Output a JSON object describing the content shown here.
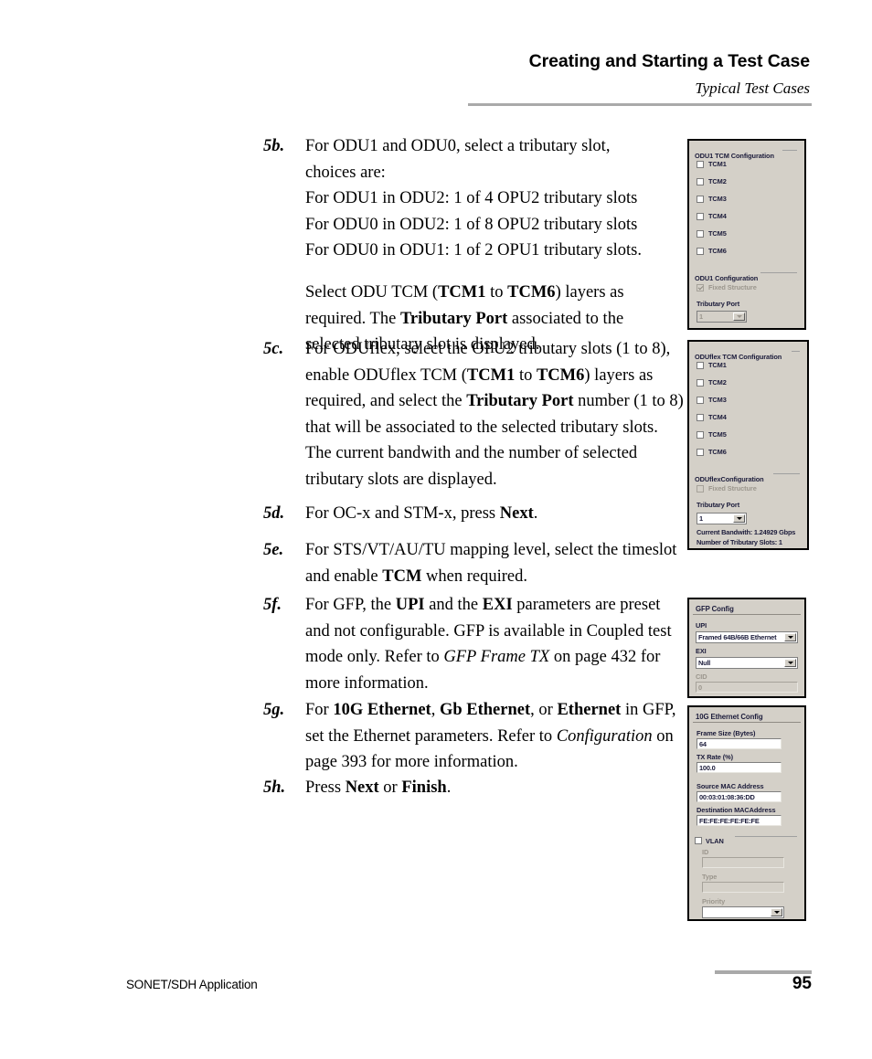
{
  "header": {
    "title": "Creating and Starting a Test Case",
    "subtitle": "Typical Test Cases"
  },
  "footer": {
    "left": "SONET/SDH Application",
    "page": "95"
  },
  "steps": [
    {
      "num": "5b.",
      "lines": [
        "For ODU1 and ODU0, select a tributary slot,",
        "choices are:",
        "For ODU1 in ODU2: 1 of 4 OPU2 tributary slots",
        "For ODU0 in ODU2: 1 of 8 OPU2 tributary slots",
        "For ODU0 in ODU1: 1 of 2 OPU1 tributary slots."
      ],
      "para2": "Select ODU TCM (TCM1 to TCM6) layers as required. The Tributary Port associated to the selected tributary slot is displayed."
    },
    {
      "num": "5c.",
      "text": "For ODUflex, select the OPU2 tributary slots (1 to 8), enable ODUflex TCM (TCM1 to TCM6) layers as required, and select the Tributary Port number (1 to 8) that will be associated to the selected tributary slots. The current bandwith and the number of selected tributary slots are displayed."
    },
    {
      "num": "5d.",
      "text": "For OC-x and STM-x, press Next."
    },
    {
      "num": "5e.",
      "text": "For STS/VT/AU/TU mapping level, select the timeslot and enable TCM when required."
    },
    {
      "num": "5f.",
      "text": "For GFP, the UPI and the EXI parameters are preset and not configurable. GFP is available in Coupled test mode only. Refer to GFP Frame TX on page 432 for more information."
    },
    {
      "num": "5g.",
      "text": "For 10G Ethernet, Gb Ethernet, or Ethernet in GFP, set the Ethernet parameters. Refer to Configuration on page 393 for more information."
    },
    {
      "num": "5h.",
      "text": "Press Next or Finish."
    }
  ],
  "panel_odu1": {
    "group1_title": "ODU1 TCM Configuration",
    "checkboxes": [
      "TCM1",
      "TCM2",
      "TCM3",
      "TCM4",
      "TCM5",
      "TCM6"
    ],
    "group2_title": "ODU1 Configuration",
    "fixed_structure_label": "Fixed Structure",
    "tributary_port_label": "Tributary Port",
    "tributary_port_value": "1"
  },
  "panel_oduflex": {
    "group1_title": "ODUflex TCM Configuration",
    "checkboxes": [
      "TCM1",
      "TCM2",
      "TCM3",
      "TCM4",
      "TCM5",
      "TCM6"
    ],
    "group2_title": "ODUflexConfiguration",
    "fixed_structure_label": "Fixed Structure",
    "tributary_port_label": "Tributary Port",
    "tributary_port_value": "1",
    "current_bandwidth": "Current Bandwith:  1.24929 Gbps",
    "number_of_slots": "Number of Tributary Slots:  1"
  },
  "panel_gfp": {
    "title": "GFP Config",
    "upi_label": "UPI",
    "upi_value": "Framed 64B/66B Ethernet",
    "exi_label": "EXI",
    "exi_value": "Null",
    "cid_label": "CID",
    "cid_value": "0"
  },
  "panel_eth": {
    "title": "10G Ethernet Config",
    "frame_size_label": "Frame Size (Bytes)",
    "frame_size_value": "64",
    "tx_rate_label": "TX Rate (%)",
    "tx_rate_value": "100.0",
    "src_mac_label": "Source MAC Address",
    "src_mac_value": "00:03:01:08:36:DD",
    "dst_mac_label": "Destination MACAddress",
    "dst_mac_value": "FE:FE:FE:FE:FE:FE",
    "vlan_label": "VLAN",
    "id_label": "ID",
    "id_value": "",
    "type_label": "Type",
    "type_value": "",
    "priority_label": "Priority",
    "priority_value": ""
  },
  "colors": {
    "panel_face": "#d4d0c8",
    "panel_text": "#1b1b3a",
    "rule": "#a9a9a9"
  }
}
